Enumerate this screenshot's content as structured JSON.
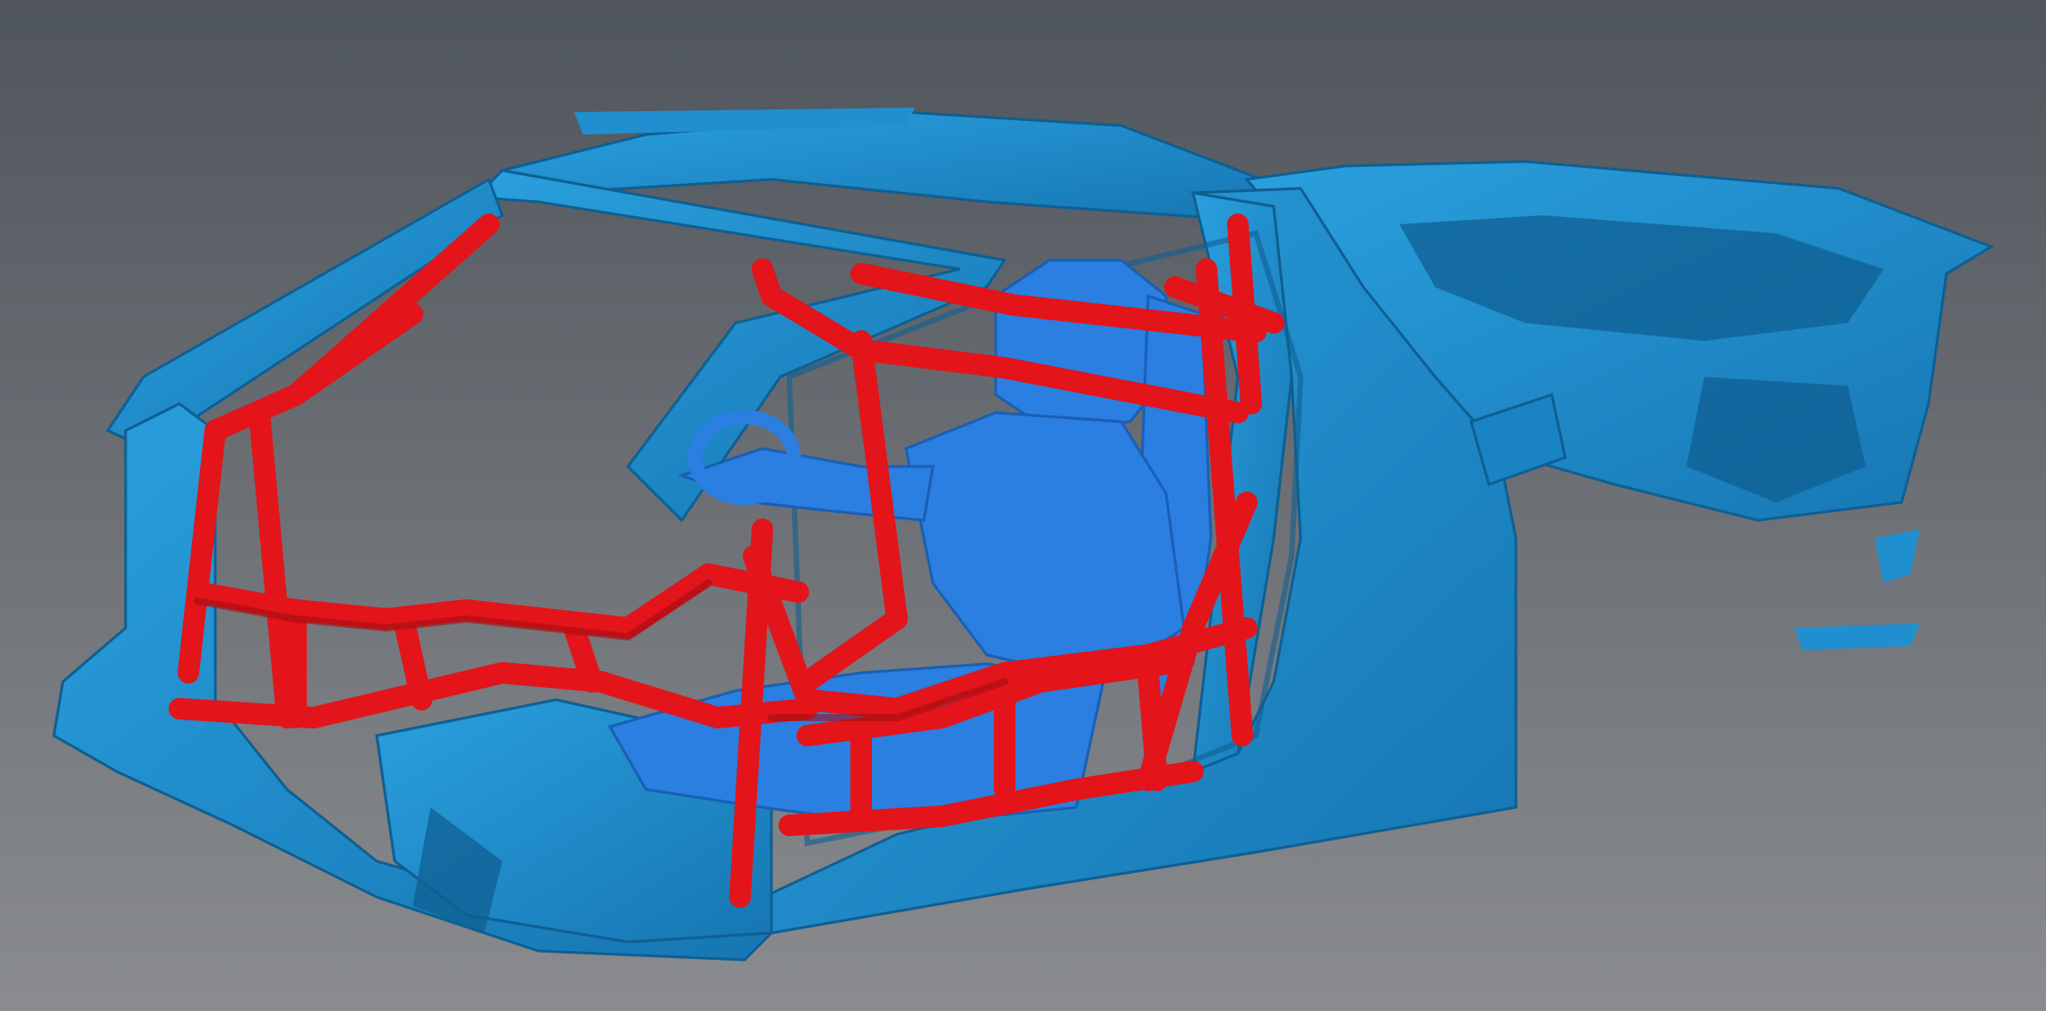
{
  "viewport": {
    "scene": "3d-scan-viewport",
    "colors": {
      "background_top": "#4f555c",
      "background_bottom": "#8a8c8f",
      "scan_mesh": "#1f8fd0",
      "scan_mesh_dark": "#116aa3",
      "driver_mesh": "#2a7fe0",
      "roll_cage": "#e3141a",
      "roll_cage_dark": "#a10e12"
    },
    "objects": [
      {
        "name": "car-body-scan",
        "color": "#1f8fd0"
      },
      {
        "name": "roll-cage-model",
        "color": "#e3141a"
      },
      {
        "name": "driver-scan",
        "color": "#2a7fe0"
      }
    ]
  }
}
